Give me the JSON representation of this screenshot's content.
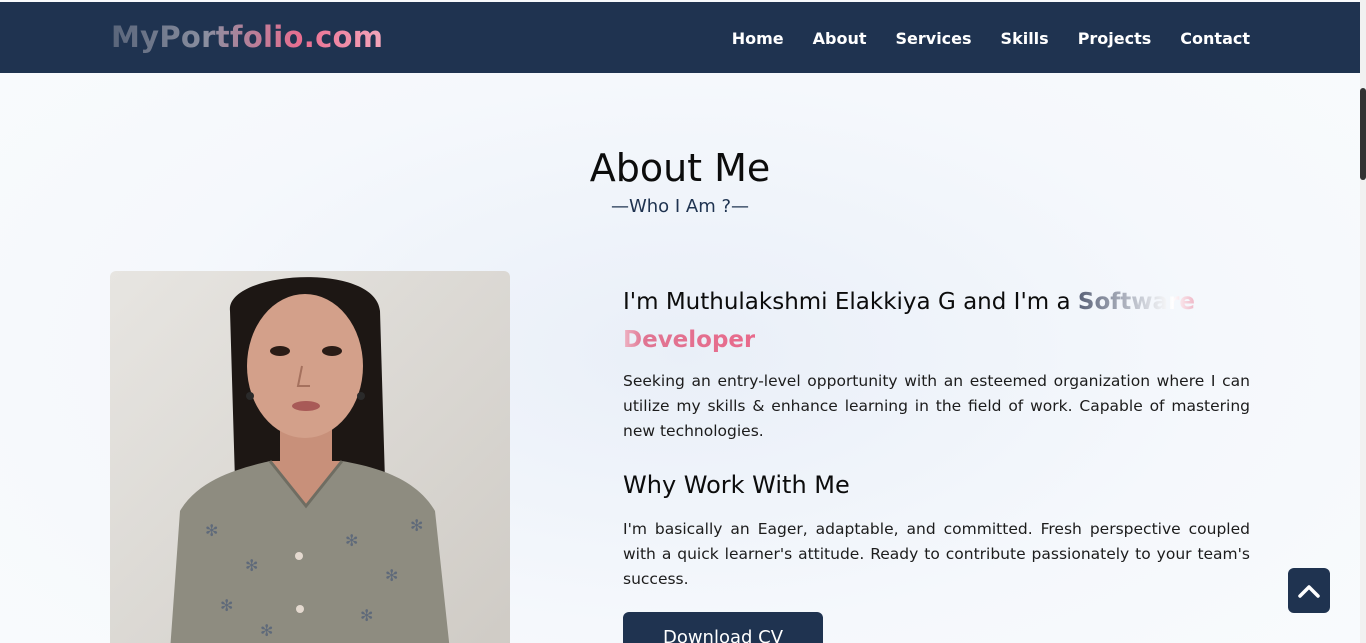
{
  "brand": {
    "logo": "MyPortfolio.com"
  },
  "nav": {
    "items": [
      {
        "label": "Home"
      },
      {
        "label": "About"
      },
      {
        "label": "Services"
      },
      {
        "label": "Skills"
      },
      {
        "label": "Projects"
      },
      {
        "label": "Contact"
      }
    ]
  },
  "about": {
    "title": "About Me",
    "subtitle": "—Who I Am ?—",
    "intro_prefix": "I'm Muthulakshmi Elakkiya G and I'm a ",
    "intro_role": "Software Developer",
    "summary": "Seeking an entry-level opportunity with an esteemed organization where I can utilize my skills & enhance learning in the field of work. Capable of mastering new technologies.",
    "why_title": "Why Work With Me",
    "why_text": "I'm basically an Eager, adaptable, and committed. Fresh perspective coupled with a quick learner's attitude. Ready to contribute passionately to your team's success.",
    "download_label": "Download CV"
  },
  "icons": {
    "scroll_top": "chevron-up-icon",
    "photo": "profile-photo"
  },
  "colors": {
    "navy": "#1f3350",
    "accent_pink": "#e86a8c",
    "text": "#0c0c0c"
  }
}
